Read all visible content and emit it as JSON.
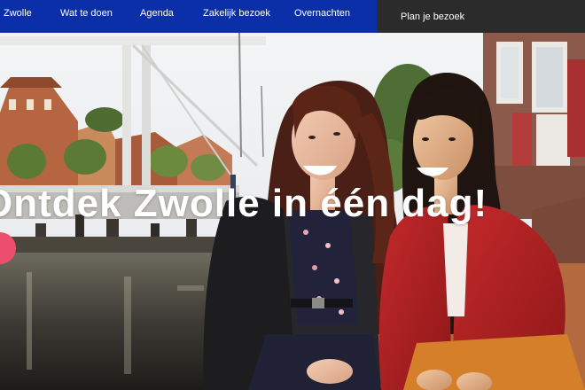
{
  "nav": {
    "items": [
      {
        "label": "Zwolle"
      },
      {
        "label": "Wat te doen"
      },
      {
        "label": "Agenda"
      },
      {
        "label": "Zakelijk bezoek"
      },
      {
        "label": "Overnachten"
      }
    ],
    "cta_label": "Plan je bezoek",
    "colors": {
      "main_bg": "#0b2fa8",
      "cta_bg": "#2b2b2b"
    }
  },
  "hero": {
    "title": "Ontdek Zwolle in één dag!",
    "accent_color": "#ef4f6f"
  }
}
